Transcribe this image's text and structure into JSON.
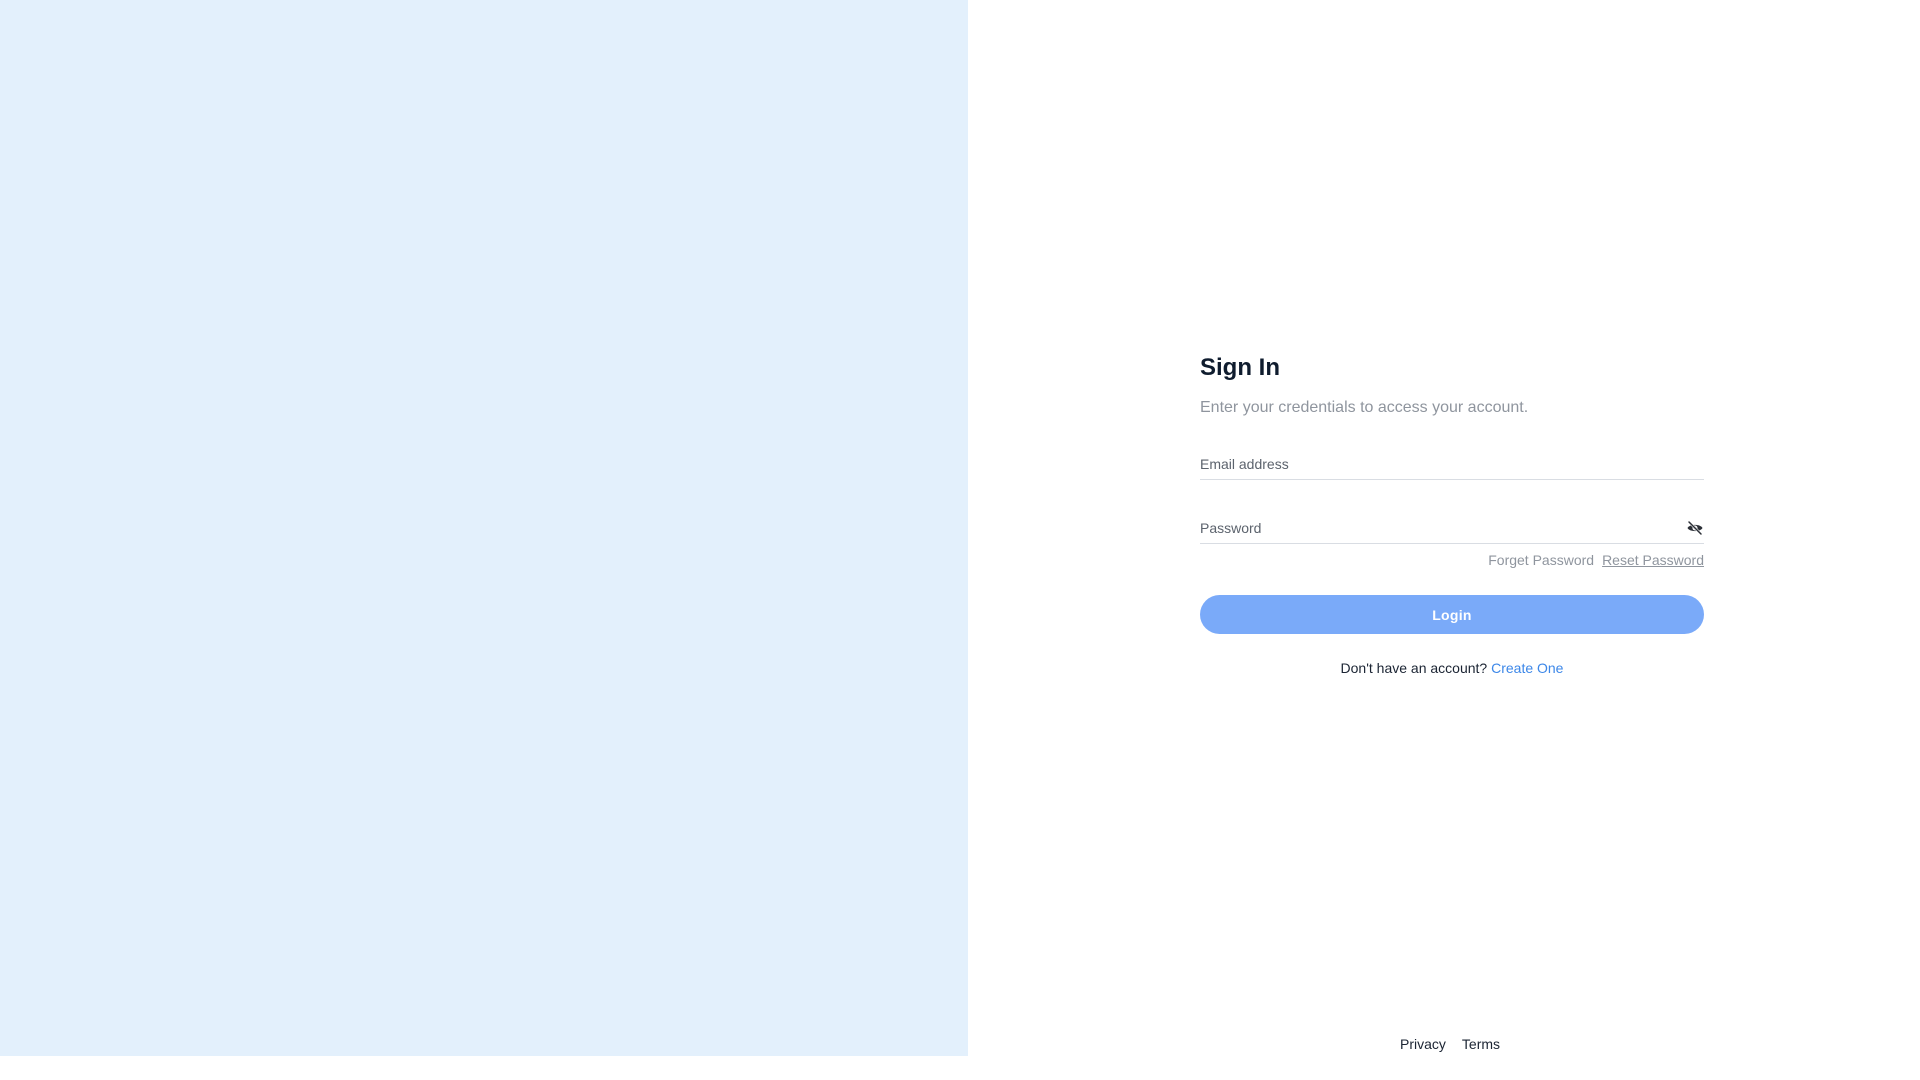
{
  "signin": {
    "title": "Sign In",
    "subtitle": "Enter your credentials to access your account.",
    "email": {
      "placeholder": "Email address",
      "value": ""
    },
    "password": {
      "placeholder": "Password",
      "value": "",
      "toggle_icon": "eye-off-icon"
    },
    "forget_password_label": "Forget Password",
    "reset_password_label": "Reset Password",
    "login_label": "Login",
    "no_account_text": "Don't have an account?",
    "create_account_label": "Create One"
  },
  "footer": {
    "privacy_label": "Privacy",
    "terms_label": "Terms"
  },
  "colors": {
    "left_panel_bg": "#e3f0fc",
    "login_button_bg": "#7aaaf9",
    "link_accent": "#3c87e8"
  }
}
